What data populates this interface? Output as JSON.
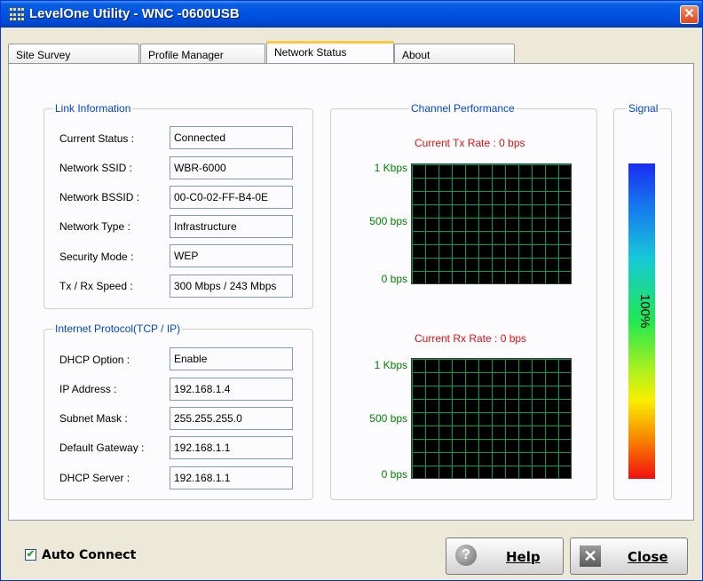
{
  "window": {
    "title": "LevelOne Utility - WNC -0600USB",
    "close_glyph": "✕"
  },
  "tabs": [
    {
      "label": "Site Survey"
    },
    {
      "label": "Profile Manager"
    },
    {
      "label": "Network Status",
      "active": true
    },
    {
      "label": "About"
    }
  ],
  "link_info": {
    "title": "Link Information",
    "rows": [
      {
        "label": "Current Status :",
        "value": "Connected"
      },
      {
        "label": "Network SSID :",
        "value": "WBR-6000"
      },
      {
        "label": "Network BSSID :",
        "value": "00-C0-02-FF-B4-0E"
      },
      {
        "label": "Network Type :",
        "value": "Infrastructure"
      },
      {
        "label": "Security Mode :",
        "value": "WEP"
      },
      {
        "label": "Tx / Rx Speed :",
        "value": "300 Mbps / 243 Mbps"
      }
    ]
  },
  "tcpip": {
    "title": "Internet Protocol(TCP / IP)",
    "rows": [
      {
        "label": "DHCP Option :",
        "value": "Enable"
      },
      {
        "label": "IP Address :",
        "value": "192.168.1.4"
      },
      {
        "label": "Subnet Mask :",
        "value": "255.255.255.0"
      },
      {
        "label": "Default Gateway :",
        "value": "192.168.1.1"
      },
      {
        "label": "DHCP Server :",
        "value": "192.168.1.1"
      }
    ]
  },
  "channel": {
    "title": "Channel Performance",
    "tx_label": "Current Tx Rate :  0 bps",
    "rx_label": "Current Rx Rate :  0 bps",
    "axis": {
      "top": "1 Kbps",
      "mid": "500 bps",
      "bottom": "0 bps"
    }
  },
  "signal": {
    "title": "Signal",
    "value_text": "100%",
    "level": 1.0
  },
  "bottom": {
    "auto_connect_label": "Auto Connect",
    "auto_connect_checked": true,
    "help_label": "Help",
    "close_label": "Close"
  },
  "colors": {
    "legend_text": "#0046d5",
    "rate_label": "#e01010",
    "axis_label": "#008000",
    "graph_grid": "#00a050"
  }
}
